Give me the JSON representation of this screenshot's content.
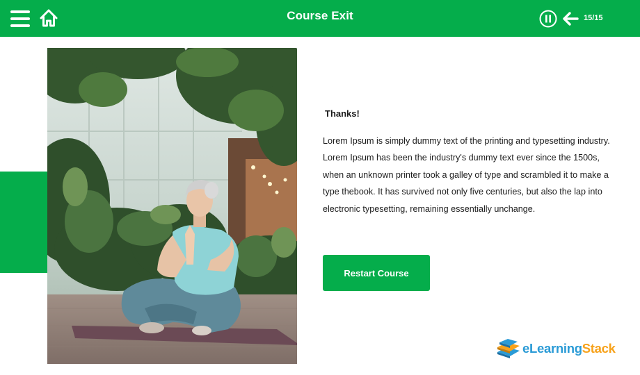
{
  "header": {
    "title": "Course Exit",
    "page_counter": "15/15",
    "menu_icon": "hamburger-menu-icon",
    "home_icon": "home-icon",
    "pause_icon": "pause-icon",
    "back_icon": "arrow-left-icon"
  },
  "content": {
    "heading": "Thanks!",
    "body": "Lorem Ipsum is simply dummy text of the printing and typesetting industry. Lorem Ipsum has been the industry's dummy text ever since the 1500s, when an unknown printer took a galley of type and scrambled it to make a type thebook. It has survived not only five centuries, but also the lap into electronic typesetting, remaining essentially unchange.",
    "restart_label": "Restart Course"
  },
  "logo": {
    "part1": "eLearning",
    "part2": "Stack"
  },
  "colors": {
    "brand_green": "#05ad4b",
    "logo_blue": "#2b9bd6",
    "logo_orange": "#f7a21b"
  }
}
